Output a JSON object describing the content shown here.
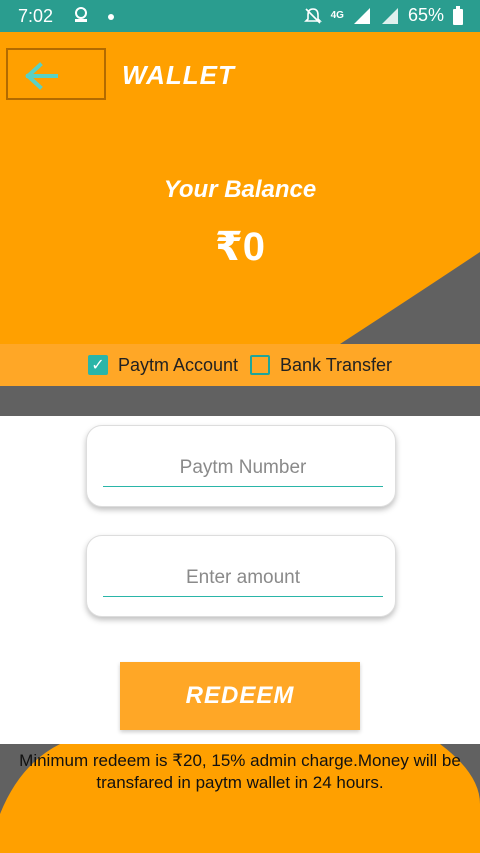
{
  "status_bar": {
    "time": "7:02",
    "network": "4G",
    "battery": "65%"
  },
  "header": {
    "title": "WALLET",
    "balance_label": "Your Balance",
    "balance_value": "₹0"
  },
  "payment_methods": {
    "paytm_label": "Paytm Account",
    "paytm_checked": true,
    "bank_label": "Bank Transfer",
    "bank_checked": false
  },
  "form": {
    "paytm_placeholder": "Paytm Number",
    "amount_placeholder": "Enter amount",
    "redeem_label": "REDEEM"
  },
  "footer": {
    "note": "Minimum redeem is ₹20, 15% admin charge.Money will be transfared in paytm wallet in 24 hours."
  },
  "colors": {
    "primary_orange": "#ffa000",
    "accent_teal": "#2ab5a8",
    "status_bar": "#2a9d8f",
    "gray": "#616161"
  },
  "icons": [
    "back-arrow-icon",
    "silent-icon",
    "signal-icon",
    "battery-icon"
  ]
}
